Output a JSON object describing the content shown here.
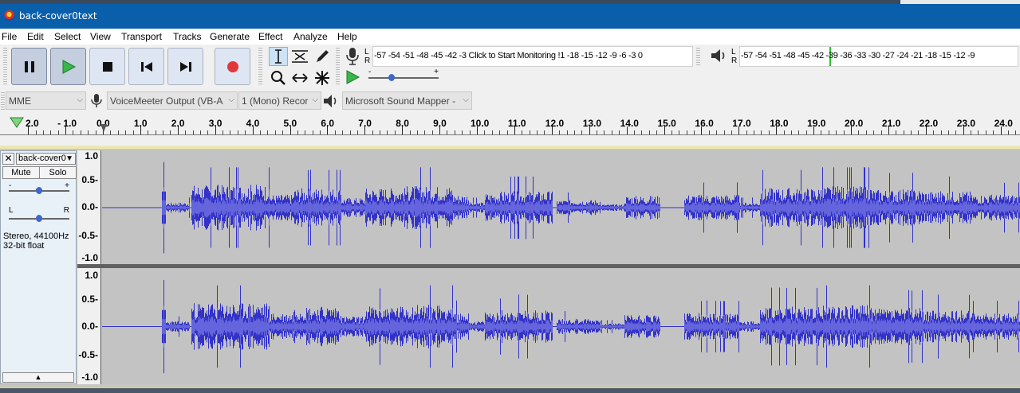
{
  "window": {
    "title": "back-cover0text"
  },
  "menu": [
    "File",
    "Edit",
    "Select",
    "View",
    "Transport",
    "Tracks",
    "Generate",
    "Effect",
    "Analyze",
    "Help"
  ],
  "transport": {
    "buttons": [
      "pause-icon",
      "play-icon",
      "stop-icon",
      "skip-to-start-icon",
      "skip-to-end-icon",
      "record-icon"
    ]
  },
  "tools": [
    "selection-tool-icon",
    "envelope-tool-icon",
    "draw-tool-icon",
    "zoom-tool-icon",
    "time-shift-tool-icon",
    "multi-tool-icon"
  ],
  "recording_meter": {
    "lr": "L\nR",
    "scale": "-57 -54 -51 -48 -45 -42 -3",
    "monitor_text": "Click to Start Monitoring",
    "scale_right": "!1 -18 -15 -12  -9  -6  -3  0"
  },
  "playback_meter": {
    "lr": "L\nR",
    "scale": "-57 -54 -51 -48 -45 -42 -39 -36 -33 -30 -27 -24 -21 -18 -15 -12  -9",
    "level_marker_db": -42
  },
  "play_at_speed": {
    "minus": "-",
    "plus": "+"
  },
  "devices": {
    "host": "MME",
    "recording_device": "VoiceMeeter Output (VB-A",
    "channels": "1 (Mono) Recor",
    "playback_device": "Microsoft Sound Mapper -"
  },
  "timeline": {
    "labels": [
      "2.0",
      "- 1.0",
      "0.0",
      "1.0",
      "2.0",
      "3.0",
      "4.0",
      "5.0",
      "6.0",
      "7.0",
      "8.0",
      "9.0",
      "10.0",
      "11.0",
      "12.0",
      "13.0",
      "14.0",
      "15.0",
      "16.0",
      "17.0",
      "18.0",
      "19.0",
      "20.0",
      "21.0",
      "22.0",
      "23.0",
      "24.0"
    ]
  },
  "track": {
    "name": "back-cover0",
    "mute": "Mute",
    "solo": "Solo",
    "gain_minus": "-",
    "gain_plus": "+",
    "pan_left": "L",
    "pan_right": "R",
    "gain_level": 0.5,
    "pan_level": 0.5,
    "info_rate": "Stereo, 44100Hz",
    "info_format": "32-bit float",
    "vertical_scale": [
      "1.0",
      "0.5-",
      "0.0-",
      "-0.5-",
      "-1.0"
    ]
  },
  "colors": {
    "titlebar": "#0a5fab",
    "waveform": "#3232c8",
    "waveform_rms": "#6464dc",
    "track_bg": "#c3c3c3",
    "play_green": "#36b84a",
    "record_red": "#e0383a"
  }
}
